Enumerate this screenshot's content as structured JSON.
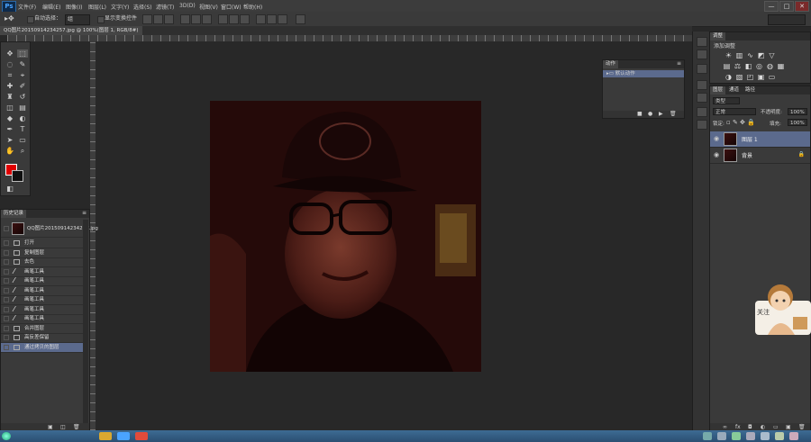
{
  "app": {
    "logo_text": "Ps",
    "menu": [
      "文件(F)",
      "编辑(E)",
      "图像(I)",
      "图层(L)",
      "文字(Y)",
      "选择(S)",
      "滤镜(T)",
      "3D(D)",
      "视图(V)",
      "窗口(W)",
      "帮助(H)"
    ],
    "window_controls": [
      "—",
      "□",
      "✕"
    ]
  },
  "options_bar": {
    "auto_select_label": "自动选择：",
    "auto_select_value": "组",
    "transform_label": "显示变换控件"
  },
  "document": {
    "tab_title": "QQ图片20150914234257.jpg @ 100%(图层 1, RGB/8#)",
    "close_glyph": "×"
  },
  "tools": [
    "▸✥",
    "⬚",
    "◌",
    "✂",
    "⌖",
    "✎",
    "♜",
    "✐",
    "◐",
    "⌕",
    "T",
    "➤",
    "▭",
    "✋",
    "🔍"
  ],
  "history": {
    "tab_label": "历史记录",
    "snapshot_label": "QQ图片20150914234257.jpg",
    "items": [
      {
        "label": "打开",
        "kind": "doc"
      },
      {
        "label": "复制图层",
        "kind": "doc"
      },
      {
        "label": "去色",
        "kind": "doc"
      },
      {
        "label": "画笔工具",
        "kind": "brush"
      },
      {
        "label": "画笔工具",
        "kind": "brush"
      },
      {
        "label": "画笔工具",
        "kind": "brush"
      },
      {
        "label": "画笔工具",
        "kind": "brush"
      },
      {
        "label": "画笔工具",
        "kind": "brush"
      },
      {
        "label": "画笔工具",
        "kind": "brush"
      },
      {
        "label": "合并图层",
        "kind": "doc"
      },
      {
        "label": "高反差保留",
        "kind": "doc"
      },
      {
        "label": "通过拷贝的图层",
        "kind": "doc"
      }
    ]
  },
  "actions_panel": {
    "tab_label": "动作",
    "item": "默认动作"
  },
  "adjustments_panel": {
    "tab_label": "调整",
    "title": "添加调整"
  },
  "layers_panel": {
    "tabs": [
      "图层",
      "通道",
      "路径"
    ],
    "blend_mode": "正常",
    "opacity_label": "不透明度:",
    "opacity_value": "100%",
    "lock_label": "锁定:",
    "fill_label": "填充:",
    "fill_value": "100%",
    "kind_filter": "类型",
    "layers": [
      {
        "name": "图层 1",
        "selected": true,
        "locked": false
      },
      {
        "name": "背景",
        "selected": false,
        "locked": true
      }
    ]
  },
  "widget": {
    "label": "关注"
  },
  "colors": {
    "foreground": "#e00000",
    "background": "#101010",
    "selection": "#5b6a8d",
    "panel": "#3a3a3a",
    "workspace": "#282828"
  }
}
